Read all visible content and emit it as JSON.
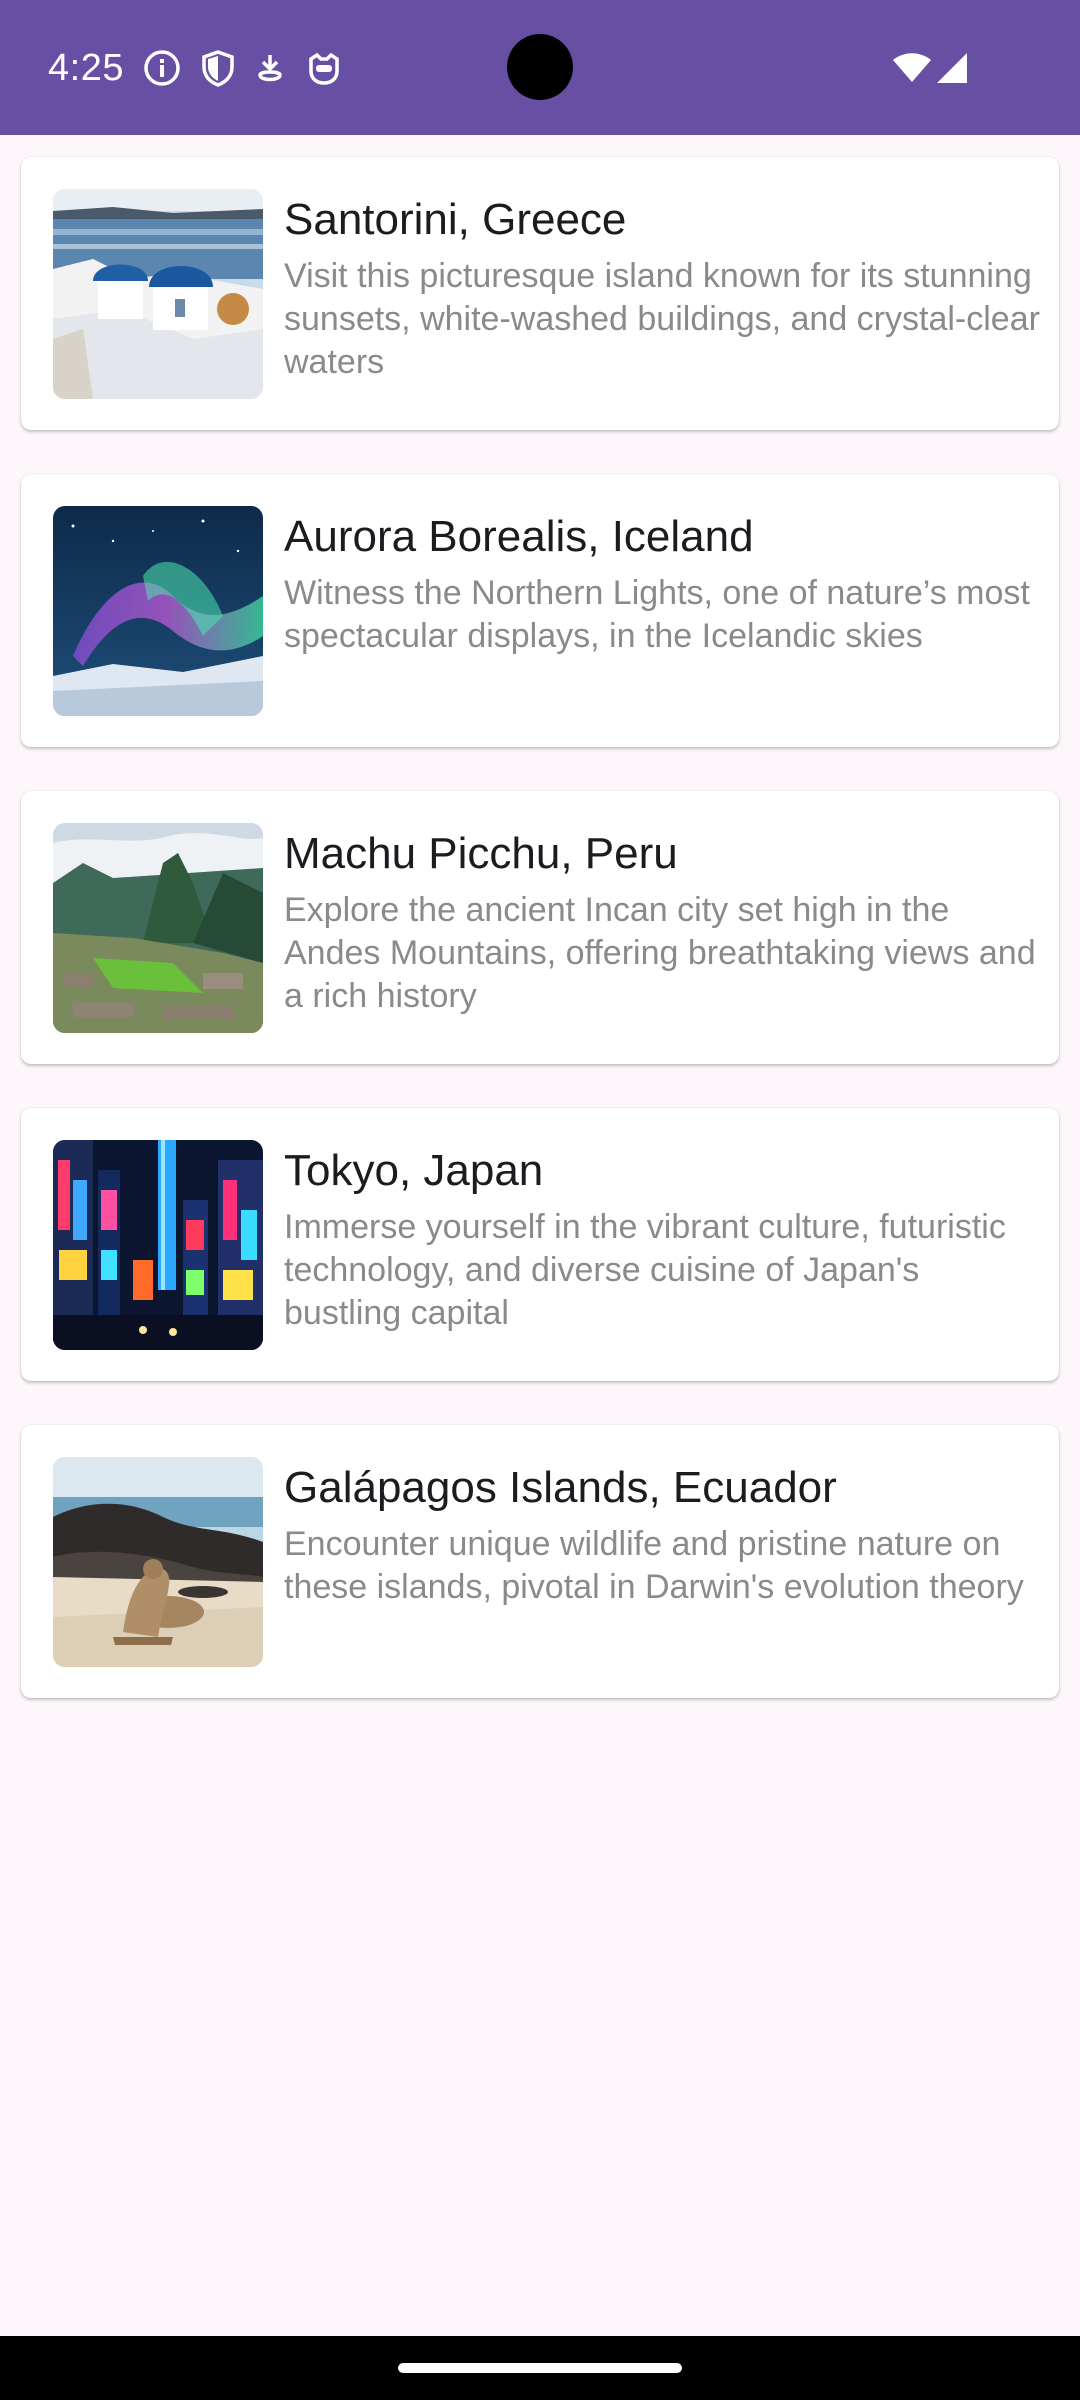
{
  "status_bar": {
    "time": "4:25",
    "left_icons": [
      "info-icon",
      "shield-icon",
      "download-icon",
      "cat-face-icon"
    ],
    "right_icons": [
      "wifi-icon",
      "cellular-signal-icon"
    ],
    "background_color": "#6750a4"
  },
  "destinations": [
    {
      "title": "Santorini, Greece",
      "description": "Visit this picturesque island known for its stunning sunsets, white-washed buildings, and crystal-clear waters"
    },
    {
      "title": "Aurora Borealis, Iceland",
      "description": "Witness the Northern Lights, one of nature’s most spectacular displays, in the Icelandic skies"
    },
    {
      "title": "Machu Picchu, Peru",
      "description": "Explore the ancient Incan city set high in the Andes Mountains, offering breathtaking views and a rich history"
    },
    {
      "title": "Tokyo, Japan",
      "description": "Immerse yourself in the vibrant culture, futuristic technology, and diverse cuisine of Japan's bustling capital"
    },
    {
      "title": "Galápagos Islands, Ecuador",
      "description": "Encounter unique wildlife and pristine nature on these islands, pivotal in Darwin's evolution theory"
    }
  ],
  "colors": {
    "background": "#fdf6fb",
    "title_text": "#1d1b20",
    "description_text": "#8a8a8a"
  }
}
